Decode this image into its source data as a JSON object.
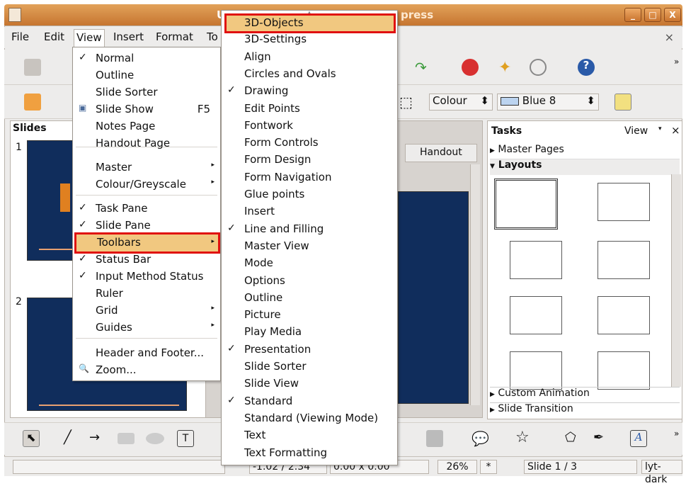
{
  "window": {
    "title_left": "U",
    "title_right": "press",
    "icon": "impress-app-icon",
    "buttons": [
      "_",
      "□",
      "X"
    ]
  },
  "menubar": {
    "items": [
      "File",
      "Edit",
      "View",
      "Insert",
      "Format",
      "To"
    ],
    "close": "×"
  },
  "toolbar2": {
    "colour_label": "Colour",
    "colour_value": "Blue 8"
  },
  "slides": {
    "title": "Slides",
    "thumbs": [
      "1",
      "2"
    ]
  },
  "center": {
    "tab_handout": "Handout"
  },
  "tasks": {
    "title": "Tasks",
    "view": "View",
    "close": "×",
    "master_pages": "Master Pages",
    "layouts": "Layouts",
    "custom_animation": "Custom Animation",
    "slide_transition": "Slide Transition"
  },
  "view_menu": {
    "items": [
      {
        "label": "Normal",
        "check": "✓"
      },
      {
        "label": "Outline"
      },
      {
        "label": "Slide Sorter"
      },
      {
        "label": "Slide Show",
        "shortcut": "F5",
        "icon": "slide-show-icon"
      },
      {
        "label": "Notes Page"
      },
      {
        "label": "Handout Page"
      },
      {
        "label": "Master",
        "arrow": "▸"
      },
      {
        "label": "Colour/Greyscale",
        "arrow": "▸"
      },
      {
        "label": "Task Pane",
        "check": "✓"
      },
      {
        "label": "Slide Pane",
        "check": "✓"
      },
      {
        "label": "Toolbars",
        "arrow": "▸"
      },
      {
        "label": "Status Bar",
        "check": "✓"
      },
      {
        "label": "Input Method Status",
        "check": "✓"
      },
      {
        "label": "Ruler"
      },
      {
        "label": "Grid",
        "arrow": "▸"
      },
      {
        "label": "Guides",
        "arrow": "▸"
      },
      {
        "label": "Header and Footer..."
      },
      {
        "label": "Zoom...",
        "icon": "zoom-icon"
      }
    ]
  },
  "toolbars_menu": {
    "items": [
      {
        "label": "3D-Objects"
      },
      {
        "label": "3D-Settings"
      },
      {
        "label": "Align"
      },
      {
        "label": "Circles and Ovals"
      },
      {
        "label": "Drawing",
        "check": "✓"
      },
      {
        "label": "Edit Points"
      },
      {
        "label": "Fontwork"
      },
      {
        "label": "Form Controls"
      },
      {
        "label": "Form Design"
      },
      {
        "label": "Form Navigation"
      },
      {
        "label": "Glue points"
      },
      {
        "label": "Insert"
      },
      {
        "label": "Line and Filling",
        "check": "✓"
      },
      {
        "label": "Master View"
      },
      {
        "label": "Mode"
      },
      {
        "label": "Options"
      },
      {
        "label": "Outline"
      },
      {
        "label": "Picture"
      },
      {
        "label": "Play Media"
      },
      {
        "label": "Presentation",
        "check": "✓"
      },
      {
        "label": "Slide Sorter"
      },
      {
        "label": "Slide View"
      },
      {
        "label": "Standard",
        "check": "✓"
      },
      {
        "label": "Standard (Viewing Mode)"
      },
      {
        "label": "Text"
      },
      {
        "label": "Text Formatting"
      }
    ]
  },
  "status": {
    "position": "-1.02 / 2.34",
    "size": "0.00 x 0.00",
    "zoom": "26%",
    "star": "*",
    "slide": "Slide 1 / 3",
    "layout": "lyt-dark"
  }
}
